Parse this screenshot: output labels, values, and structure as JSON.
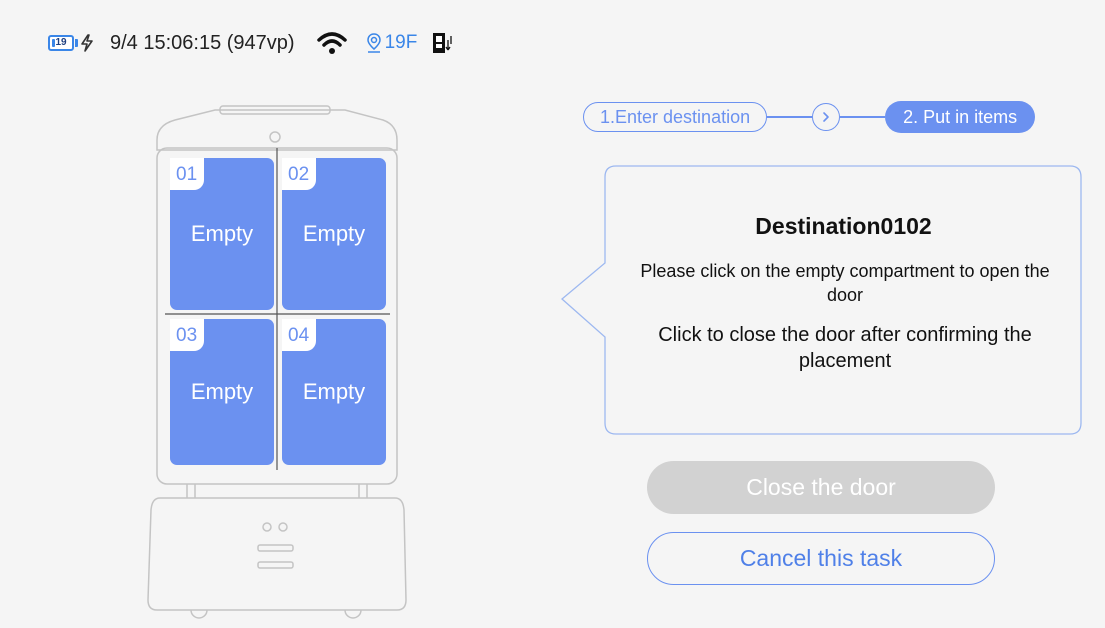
{
  "status_bar": {
    "battery_level": "19",
    "battery_fraction": 0.19,
    "datetime": "9/4 15:06:15 (947vp)",
    "floor": "19F",
    "icons": [
      "battery-icon",
      "charging-bolt-icon",
      "wifi-icon",
      "location-pin-icon",
      "elevator-icon"
    ]
  },
  "compartments": [
    {
      "number": "01",
      "status": "Empty"
    },
    {
      "number": "02",
      "status": "Empty"
    },
    {
      "number": "03",
      "status": "Empty"
    },
    {
      "number": "04",
      "status": "Empty"
    }
  ],
  "stepper": {
    "step1": "1.Enter destination",
    "step2": "2. Put in items"
  },
  "instructions": {
    "title": "Destination0102",
    "line1": "Please click on the empty compartment to open the door",
    "line2": "Click to close the door after confirming the placement"
  },
  "buttons": {
    "close_door": "Close the door",
    "cancel_task": "Cancel this task"
  },
  "colors": {
    "accent": "#6b91f0",
    "status_blue": "#3a86e8",
    "disabled_button": "#d2d2d2",
    "background": "#f5f5f5"
  }
}
